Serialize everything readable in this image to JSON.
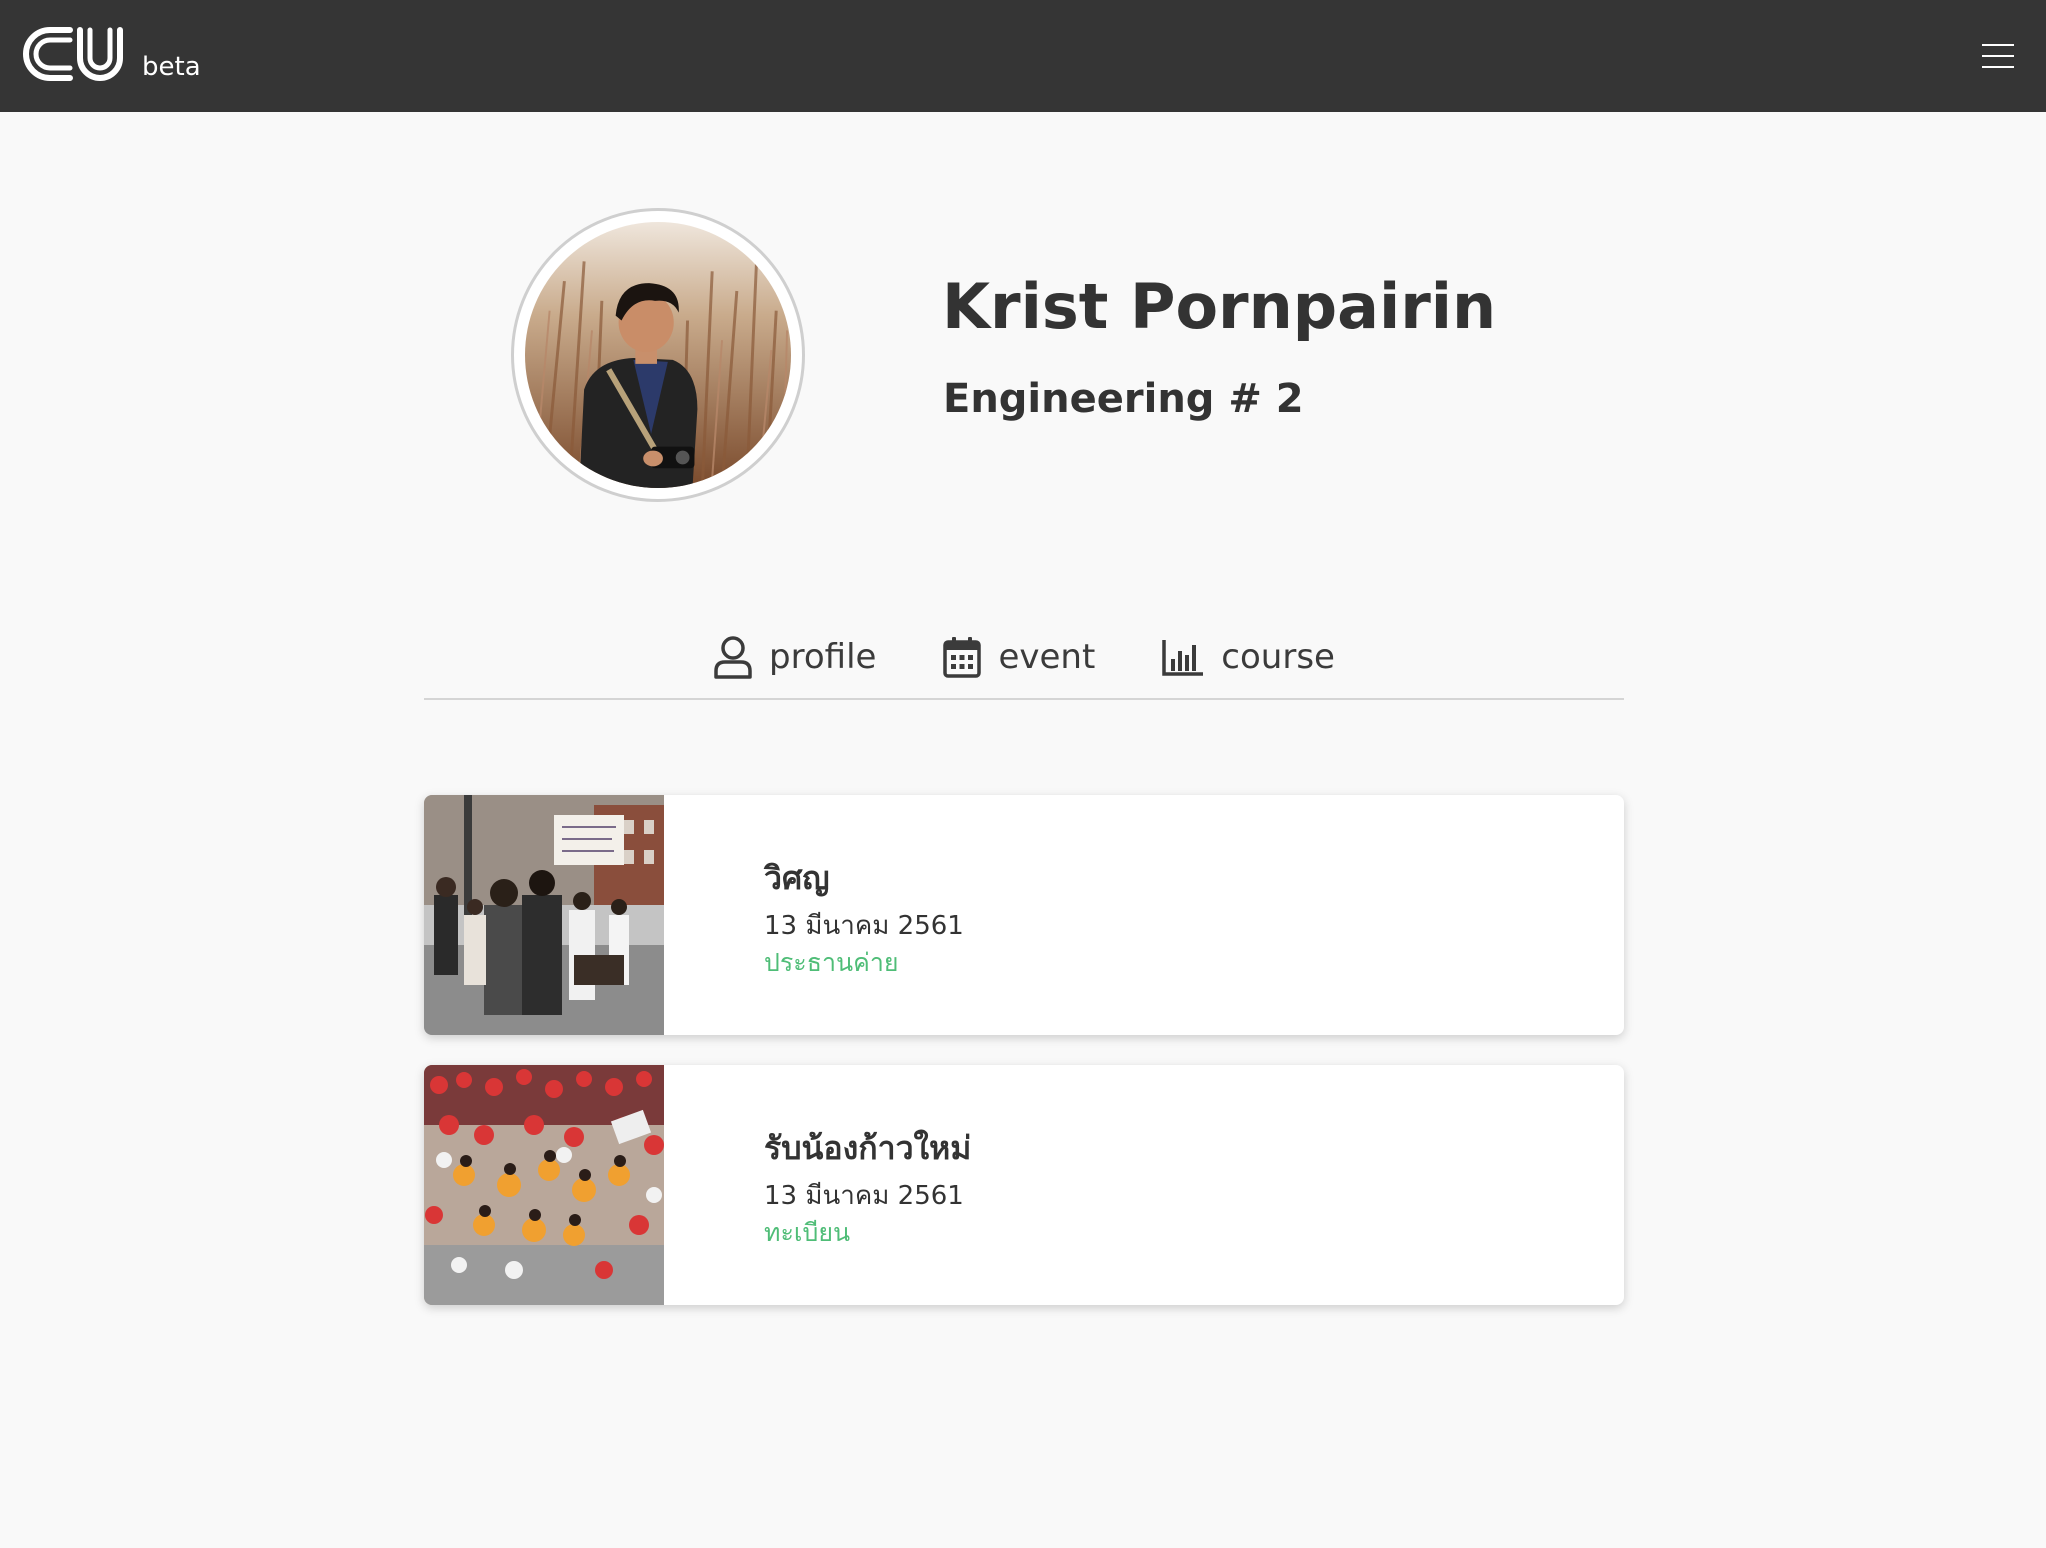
{
  "header": {
    "logo_text": "CU",
    "logo_badge": "beta",
    "menu_icon": "hamburger-menu-icon"
  },
  "profile": {
    "name": "Krist Pornpairin",
    "subtitle": "Engineering # 2",
    "avatar_alt": "profile photo"
  },
  "tabs": [
    {
      "label": "profile",
      "icon": "user-icon"
    },
    {
      "label": "event",
      "icon": "calendar-icon"
    },
    {
      "label": "course",
      "icon": "bar-chart-icon"
    }
  ],
  "events": [
    {
      "title": "วิศญ",
      "date": "13 มีนาคม 2561",
      "role": "ประธานค่าย"
    },
    {
      "title": "รับน้องก้าวใหม่",
      "date": "13 มีนาคม 2561",
      "role": "ทะเบียน"
    }
  ],
  "colors": {
    "header_bg": "#353535",
    "page_bg": "#f9f9f9",
    "role_text": "#4fbd77",
    "primary_text": "#333333"
  }
}
